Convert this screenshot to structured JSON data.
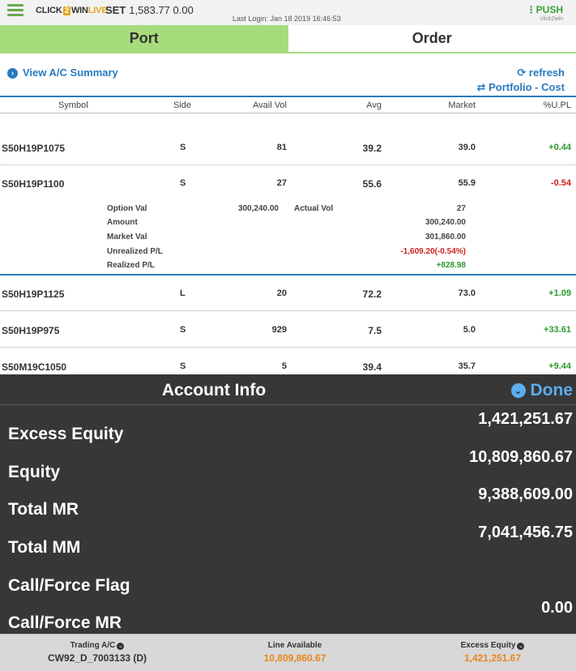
{
  "header": {
    "brand_click": "CLICK",
    "brand_two": "2",
    "brand_win": "WIN",
    "brand_live": "LIVE",
    "index_name": "SET",
    "index_value": "1,583.77 0.00",
    "last_login": "Last Login: Jan 18 2019 16:46:53",
    "push_label": "PUSH",
    "push_sub": "click2win"
  },
  "tabs": [
    {
      "label": "Port",
      "active": true
    },
    {
      "label": "Order",
      "active": false
    }
  ],
  "actions": {
    "view_summary": "View A/C Summary",
    "refresh": "refresh",
    "portfolio_cost": "Portfolio - Cost"
  },
  "table": {
    "headers": [
      "Symbol",
      "Side",
      "Avail Vol",
      "Avg",
      "Market",
      "%U.PL"
    ],
    "rows": [
      {
        "symbol": "S50H19P1075",
        "side": "S",
        "avail_vol": "81",
        "avg": "39.2",
        "market": "39.0",
        "upl": "+0.44"
      },
      {
        "symbol": "S50H19P1100",
        "side": "S",
        "avail_vol": "27",
        "avg": "55.6",
        "market": "55.9",
        "upl": "-0.54"
      },
      {
        "symbol": "S50H19P1125",
        "side": "L",
        "avail_vol": "20",
        "avg": "72.2",
        "market": "73.0",
        "upl": "+1.09"
      },
      {
        "symbol": "S50H19P975",
        "side": "S",
        "avail_vol": "929",
        "avg": "7.5",
        "market": "5.0",
        "upl": "+33.61"
      },
      {
        "symbol": "S50M19C1050",
        "side": "S",
        "avail_vol": "5",
        "avg": "39.4",
        "market": "35.7",
        "upl": "+9.44"
      }
    ]
  },
  "detail": {
    "option_val_label": "Option Val",
    "option_val": "300,240.00",
    "actual_vol_label": "Actual Vol",
    "actual_vol": "27",
    "amount_label": "Amount",
    "amount": "300,240.00",
    "market_val_label": "Market Val",
    "market_val": "301,860.00",
    "unrealized_label": "Unrealized P/L",
    "unrealized": "-1,609.20(-0.54%)",
    "realized_label": "Realized P/L",
    "realized": "+828.98"
  },
  "account_info": {
    "title": "Account Info",
    "done": "Done",
    "items": [
      {
        "label": "Excess Equity",
        "value": "1,421,251.67"
      },
      {
        "label": "Equity",
        "value": "10,809,860.67"
      },
      {
        "label": "Total MR",
        "value": "9,388,609.00"
      },
      {
        "label": "Total MM",
        "value": "7,041,456.75"
      },
      {
        "label": "Call/Force Flag",
        "value": ""
      },
      {
        "label": "Call/Force MR",
        "value": "0.00"
      }
    ]
  },
  "footer": {
    "trading_label": "Trading A/C",
    "trading_value": "CW92_D_7003133 (D)",
    "line_label": "Line Available",
    "line_value": "10,809,860.67",
    "excess_label": "Excess Equity",
    "excess_value": "1,421,251.67"
  },
  "colors": {
    "accent_green": "#a7dc7c",
    "link_blue": "#2a7abf",
    "positive": "#2e9a2e",
    "negative": "#d02020",
    "orange": "#e8861a"
  }
}
